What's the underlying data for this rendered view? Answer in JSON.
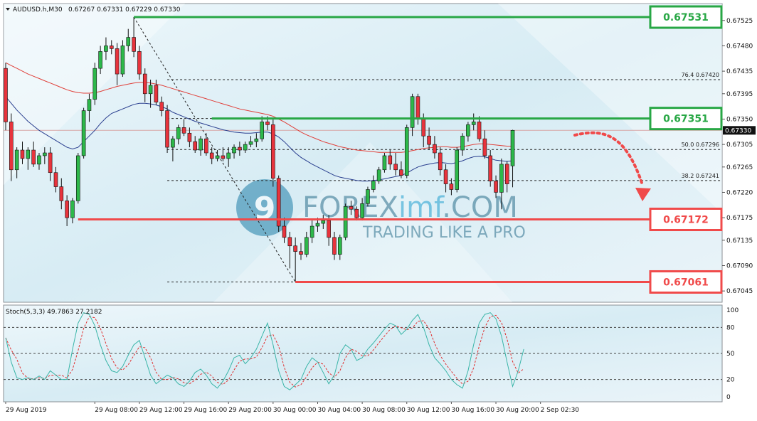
{
  "header": {
    "symbol": "AUDUSD.h,M30",
    "ohlc": "0.67267 0.67331 0.67229 0.67330",
    "stoch_label": "Stoch(5,3,3) 49.7863 27.2182"
  },
  "watermark": {
    "brand_part1": "FOREX",
    "brand_part2": "imf",
    "brand_part3": ".COM",
    "tagline": "TRADING LIKE A PRO"
  },
  "colors": {
    "bull": "#2db84a",
    "bear": "#e8333c",
    "ma_fast": "#2a3f8f",
    "ma_slow": "#e0403a",
    "level_green": "#28a745",
    "level_red": "#f04a4a",
    "stoch_main": "#3ab5a8",
    "stoch_signal": "#e03030"
  },
  "chart_data": {
    "type": "candlestick",
    "ylim": [
      0.67025,
      0.67555
    ],
    "y_ticks": [
      "0.67525",
      "0.67480",
      "0.67435",
      "0.67395",
      "0.67350",
      "0.67305",
      "0.67265",
      "0.67220",
      "0.67175",
      "0.67135",
      "0.67090",
      "0.67045"
    ],
    "current_price": "0.67330",
    "x_labels": [
      {
        "label": "29 Aug 2019",
        "i": 0
      },
      {
        "label": "29 Aug 08:00",
        "i": 16
      },
      {
        "label": "29 Aug 12:00",
        "i": 24
      },
      {
        "label": "29 Aug 16:00",
        "i": 32
      },
      {
        "label": "29 Aug 20:00",
        "i": 40
      },
      {
        "label": "30 Aug 00:00",
        "i": 48
      },
      {
        "label": "30 Aug 04:00",
        "i": 56
      },
      {
        "label": "30 Aug 08:00",
        "i": 64
      },
      {
        "label": "30 Aug 12:00",
        "i": 72
      },
      {
        "label": "30 Aug 16:00",
        "i": 80
      },
      {
        "label": "30 Aug 20:00",
        "i": 88
      },
      {
        "label": "2 Sep 02:30",
        "i": 96
      }
    ],
    "candles": [
      [
        0.6744,
        0.6745,
        0.6733,
        0.67345
      ],
      [
        0.67345,
        0.6736,
        0.6724,
        0.6726
      ],
      [
        0.6726,
        0.673,
        0.67245,
        0.67295
      ],
      [
        0.67295,
        0.6731,
        0.6727,
        0.6728
      ],
      [
        0.6728,
        0.673,
        0.6726,
        0.67295
      ],
      [
        0.67295,
        0.6731,
        0.67265,
        0.6727
      ],
      [
        0.6727,
        0.6729,
        0.6726,
        0.67285
      ],
      [
        0.67285,
        0.673,
        0.6727,
        0.6729
      ],
      [
        0.6729,
        0.673,
        0.6724,
        0.67255
      ],
      [
        0.67255,
        0.67265,
        0.6722,
        0.6723
      ],
      [
        0.6723,
        0.67245,
        0.6719,
        0.67205
      ],
      [
        0.67205,
        0.67215,
        0.6716,
        0.67175
      ],
      [
        0.67175,
        0.6721,
        0.67165,
        0.67205
      ],
      [
        0.67205,
        0.6729,
        0.672,
        0.67285
      ],
      [
        0.67285,
        0.6737,
        0.6728,
        0.67365
      ],
      [
        0.67365,
        0.67395,
        0.67345,
        0.67385
      ],
      [
        0.67385,
        0.6745,
        0.67375,
        0.6744
      ],
      [
        0.6744,
        0.6748,
        0.6743,
        0.6747
      ],
      [
        0.6747,
        0.67495,
        0.67455,
        0.6748
      ],
      [
        0.6748,
        0.6749,
        0.67465,
        0.67475
      ],
      [
        0.67475,
        0.67485,
        0.6741,
        0.6743
      ],
      [
        0.6743,
        0.6749,
        0.67425,
        0.6748
      ],
      [
        0.6748,
        0.6751,
        0.6747,
        0.67495
      ],
      [
        0.67495,
        0.67531,
        0.6746,
        0.6747
      ],
      [
        0.6747,
        0.6748,
        0.6742,
        0.6743
      ],
      [
        0.6743,
        0.6744,
        0.6738,
        0.67395
      ],
      [
        0.67395,
        0.6742,
        0.6737,
        0.6741
      ],
      [
        0.6741,
        0.6742,
        0.67375,
        0.6738
      ],
      [
        0.6738,
        0.6739,
        0.67355,
        0.67365
      ],
      [
        0.67365,
        0.67375,
        0.6729,
        0.673
      ],
      [
        0.673,
        0.6732,
        0.67275,
        0.67315
      ],
      [
        0.67315,
        0.6734,
        0.67305,
        0.67335
      ],
      [
        0.67335,
        0.6735,
        0.6732,
        0.67325
      ],
      [
        0.67325,
        0.67335,
        0.673,
        0.6731
      ],
      [
        0.6731,
        0.6732,
        0.6729,
        0.67295
      ],
      [
        0.67295,
        0.6732,
        0.67285,
        0.67315
      ],
      [
        0.67315,
        0.67325,
        0.67285,
        0.6729
      ],
      [
        0.6729,
        0.673,
        0.6727,
        0.6728
      ],
      [
        0.6728,
        0.67295,
        0.67275,
        0.67285
      ],
      [
        0.67285,
        0.673,
        0.67275,
        0.6728
      ],
      [
        0.6728,
        0.673,
        0.67265,
        0.6729
      ],
      [
        0.6729,
        0.67305,
        0.6728,
        0.673
      ],
      [
        0.673,
        0.6731,
        0.67285,
        0.67295
      ],
      [
        0.67295,
        0.6731,
        0.6729,
        0.67305
      ],
      [
        0.67305,
        0.6732,
        0.673,
        0.6731
      ],
      [
        0.6731,
        0.67325,
        0.673,
        0.67315
      ],
      [
        0.67315,
        0.67355,
        0.6731,
        0.67345
      ],
      [
        0.67345,
        0.67355,
        0.6733,
        0.6734
      ],
      [
        0.6734,
        0.6735,
        0.6723,
        0.67245
      ],
      [
        0.67245,
        0.6725,
        0.6715,
        0.6716
      ],
      [
        0.6716,
        0.67175,
        0.6713,
        0.6714
      ],
      [
        0.6714,
        0.6715,
        0.67085,
        0.67125
      ],
      [
        0.67125,
        0.6714,
        0.67061,
        0.67115
      ],
      [
        0.67115,
        0.6713,
        0.671,
        0.6711
      ],
      [
        0.6711,
        0.6715,
        0.67105,
        0.6714
      ],
      [
        0.6714,
        0.6717,
        0.6713,
        0.6716
      ],
      [
        0.6716,
        0.67175,
        0.6715,
        0.67165
      ],
      [
        0.67165,
        0.6718,
        0.67155,
        0.6717
      ],
      [
        0.6717,
        0.6718,
        0.67125,
        0.6714
      ],
      [
        0.6714,
        0.6715,
        0.671,
        0.6711
      ],
      [
        0.6711,
        0.67145,
        0.671,
        0.6714
      ],
      [
        0.6714,
        0.672,
        0.67135,
        0.67195
      ],
      [
        0.67195,
        0.67205,
        0.6718,
        0.6719
      ],
      [
        0.6719,
        0.67195,
        0.6717,
        0.67175
      ],
      [
        0.67175,
        0.6721,
        0.6717,
        0.672
      ],
      [
        0.672,
        0.6723,
        0.67195,
        0.67225
      ],
      [
        0.67225,
        0.6725,
        0.6722,
        0.6724
      ],
      [
        0.6724,
        0.67265,
        0.67235,
        0.6726
      ],
      [
        0.6726,
        0.6729,
        0.67255,
        0.67285
      ],
      [
        0.67285,
        0.67295,
        0.6726,
        0.6727
      ],
      [
        0.6727,
        0.6729,
        0.6725,
        0.6726
      ],
      [
        0.6726,
        0.67275,
        0.67245,
        0.6725
      ],
      [
        0.6725,
        0.6734,
        0.67245,
        0.67335
      ],
      [
        0.67335,
        0.67395,
        0.6732,
        0.6739
      ],
      [
        0.6739,
        0.67395,
        0.6734,
        0.6735
      ],
      [
        0.6735,
        0.6736,
        0.673,
        0.6732
      ],
      [
        0.6732,
        0.67335,
        0.67295,
        0.67305
      ],
      [
        0.67305,
        0.6732,
        0.6728,
        0.6729
      ],
      [
        0.6729,
        0.673,
        0.6725,
        0.6726
      ],
      [
        0.6726,
        0.6727,
        0.6722,
        0.67235
      ],
      [
        0.67235,
        0.67245,
        0.67215,
        0.67225
      ],
      [
        0.67225,
        0.673,
        0.6722,
        0.67295
      ],
      [
        0.67295,
        0.67325,
        0.67285,
        0.6732
      ],
      [
        0.6732,
        0.67345,
        0.6731,
        0.6734
      ],
      [
        0.6734,
        0.6736,
        0.6733,
        0.67345
      ],
      [
        0.67345,
        0.67355,
        0.6731,
        0.67315
      ],
      [
        0.67315,
        0.6733,
        0.6728,
        0.67285
      ],
      [
        0.67285,
        0.67295,
        0.6723,
        0.6724
      ],
      [
        0.6724,
        0.6725,
        0.6721,
        0.6722
      ],
      [
        0.6722,
        0.6728,
        0.6719,
        0.6727
      ],
      [
        0.6727,
        0.67275,
        0.6722,
        0.67235
      ],
      [
        0.67267,
        0.67331,
        0.67229,
        0.6733
      ]
    ],
    "ma_fast": [
      0.6739,
      0.67378,
      0.67366,
      0.67356,
      0.67346,
      0.67338,
      0.6733,
      0.67324,
      0.67318,
      0.67312,
      0.67306,
      0.673,
      0.67297,
      0.673,
      0.6731,
      0.6732,
      0.6733,
      0.67342,
      0.67352,
      0.6736,
      0.67364,
      0.67368,
      0.67372,
      0.67376,
      0.67378,
      0.67378,
      0.67377,
      0.67375,
      0.67372,
      0.67368,
      0.67362,
      0.67358,
      0.67354,
      0.6735,
      0.67346,
      0.67343,
      0.6734,
      0.67337,
      0.67334,
      0.67331,
      0.67329,
      0.67327,
      0.67326,
      0.67325,
      0.67325,
      0.67326,
      0.67327,
      0.67327,
      0.67324,
      0.67318,
      0.6731,
      0.673,
      0.6729,
      0.67282,
      0.67276,
      0.6727,
      0.67265,
      0.6726,
      0.67255,
      0.6725,
      0.67247,
      0.67245,
      0.67243,
      0.67241,
      0.6724,
      0.6724,
      0.67241,
      0.67242,
      0.67244,
      0.67246,
      0.67248,
      0.6725,
      0.67254,
      0.6726,
      0.67265,
      0.67268,
      0.6727,
      0.67272,
      0.67273,
      0.67272,
      0.67271,
      0.67273,
      0.67276,
      0.6728,
      0.67283,
      0.67284,
      0.67283,
      0.6728,
      0.67277,
      0.67276,
      0.67275,
      0.67276
    ],
    "ma_slow": [
      0.6745,
      0.67445,
      0.6744,
      0.67435,
      0.6743,
      0.67426,
      0.67422,
      0.67418,
      0.67414,
      0.6741,
      0.67406,
      0.67402,
      0.67399,
      0.67397,
      0.67396,
      0.67396,
      0.67397,
      0.67399,
      0.67402,
      0.67405,
      0.67408,
      0.6741,
      0.67412,
      0.67414,
      0.67415,
      0.67415,
      0.67414,
      0.67412,
      0.6741,
      0.67407,
      0.67404,
      0.67401,
      0.67398,
      0.67395,
      0.67392,
      0.67389,
      0.67386,
      0.67383,
      0.6738,
      0.67377,
      0.67374,
      0.67371,
      0.67368,
      0.67366,
      0.67364,
      0.67362,
      0.6736,
      0.67358,
      0.67355,
      0.6735,
      0.67345,
      0.67339,
      0.67333,
      0.67327,
      0.67322,
      0.67318,
      0.67314,
      0.6731,
      0.67307,
      0.67304,
      0.67301,
      0.67299,
      0.67297,
      0.67295,
      0.67294,
      0.67293,
      0.67292,
      0.67291,
      0.67291,
      0.67291,
      0.67291,
      0.67291,
      0.67292,
      0.67294,
      0.67296,
      0.67298,
      0.67299,
      0.673,
      0.67301,
      0.67301,
      0.673,
      0.673,
      0.67301,
      0.67303,
      0.67305,
      0.67306,
      0.67306,
      0.67305,
      0.67304,
      0.67303,
      0.67302,
      0.67302
    ],
    "levels": [
      {
        "label": "0.67531",
        "price": 0.67531,
        "color": "green",
        "from_i": 23
      },
      {
        "label": "0.67351",
        "price": 0.67351,
        "color": "green",
        "from_i": 37
      },
      {
        "label": "0.67172",
        "price": 0.67172,
        "color": "red",
        "from_i": 13
      },
      {
        "label": "0.67061",
        "price": 0.67061,
        "color": "red",
        "from_i": 52
      }
    ],
    "fib_levels": [
      {
        "label": "76.4  0.67420",
        "price": 0.6742,
        "from_i": 29
      },
      {
        "label": "50.0  0.67296",
        "price": 0.67296,
        "from_i": 29
      },
      {
        "label": "38.2  0.67241",
        "price": 0.67241,
        "from_i": 29
      }
    ],
    "fib_extra_lines": [
      0.67351,
      0.67061
    ],
    "stoch": {
      "levels": [
        "100",
        "80",
        "50",
        "20",
        "0"
      ],
      "dashed": [
        80,
        50,
        20
      ],
      "main": [
        68,
        40,
        22,
        20,
        22,
        20,
        24,
        20,
        30,
        25,
        20,
        20,
        55,
        85,
        97,
        95,
        82,
        60,
        42,
        30,
        28,
        35,
        48,
        60,
        65,
        45,
        25,
        15,
        20,
        25,
        22,
        15,
        12,
        18,
        28,
        32,
        25,
        15,
        10,
        18,
        30,
        45,
        48,
        38,
        45,
        55,
        70,
        85,
        60,
        30,
        12,
        8,
        14,
        20,
        35,
        45,
        40,
        28,
        15,
        25,
        50,
        60,
        55,
        42,
        45,
        55,
        62,
        70,
        78,
        85,
        82,
        72,
        78,
        88,
        95,
        80,
        60,
        45,
        38,
        30,
        20,
        14,
        10,
        30,
        60,
        85,
        95,
        97,
        90,
        70,
        40,
        12,
        30,
        55
      ]
    }
  }
}
